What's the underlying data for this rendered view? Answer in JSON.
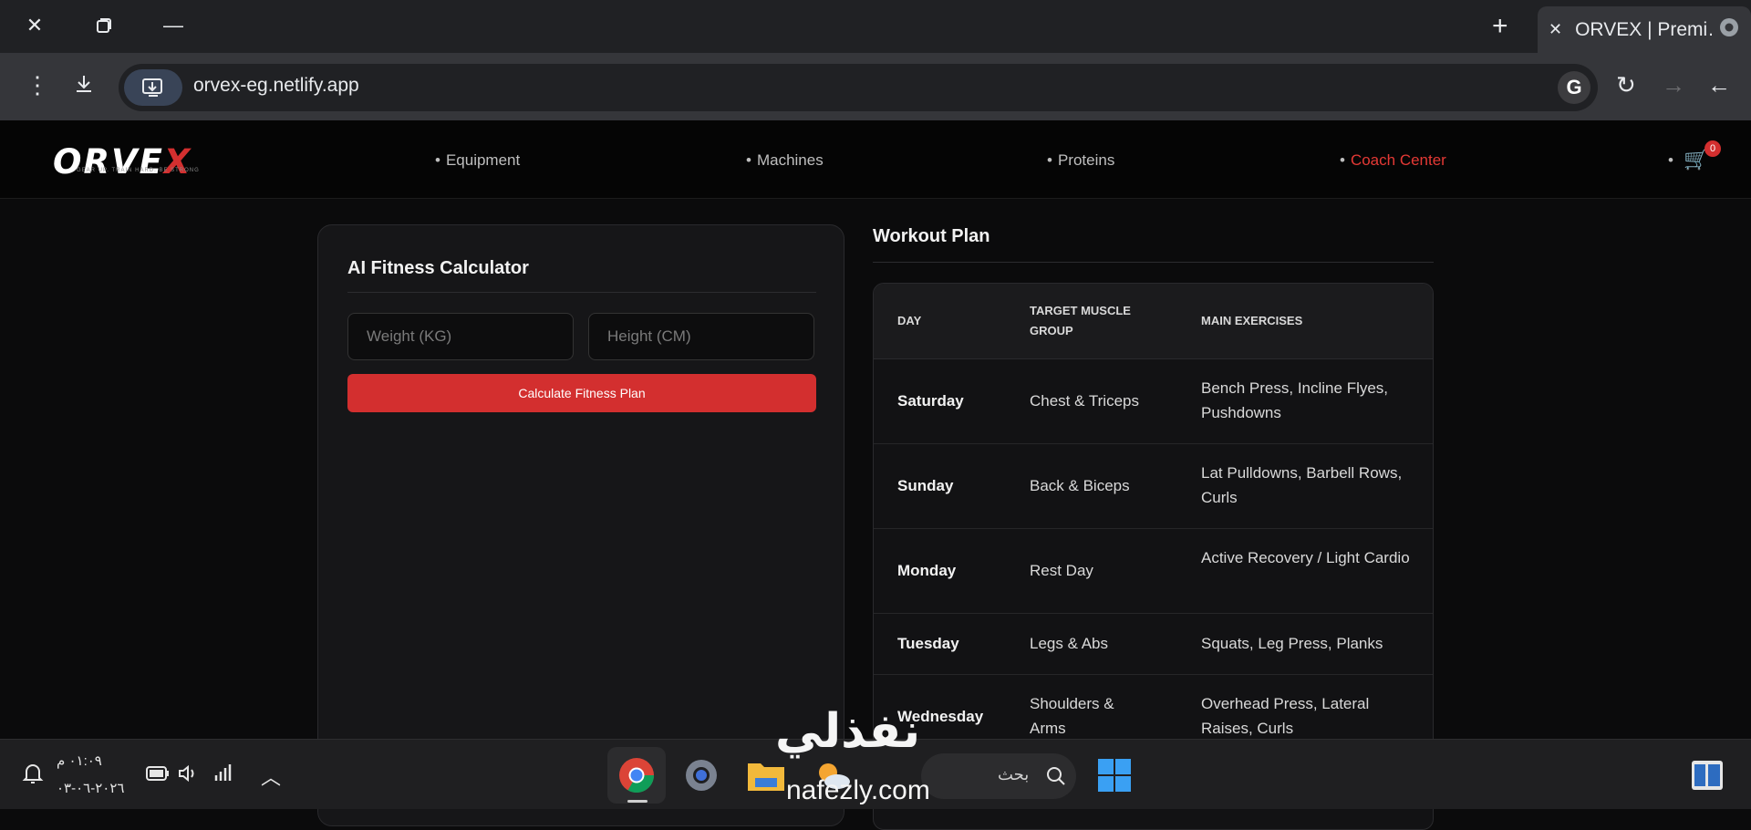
{
  "browser": {
    "tab_title": "ORVEX | Premi…",
    "url": "orvex-eg.netlify.app"
  },
  "site": {
    "logo": "ORVEX",
    "logo_tagline": "GEAR UP. TRAIN HARD. BE STRONG",
    "nav": [
      {
        "label": "Equipment"
      },
      {
        "label": "Machines"
      },
      {
        "label": "Proteins"
      },
      {
        "label": "Coach Center"
      }
    ],
    "cart_count": "0"
  },
  "calculator": {
    "title": "AI Fitness Calculator",
    "weight_placeholder": "Weight (KG)",
    "height_placeholder": "Height (CM)",
    "button_label": "Calculate Fitness Plan"
  },
  "workout": {
    "title": "Workout Plan",
    "headers": {
      "day": "DAY",
      "group_line1": "TARGET MUSCLE",
      "group_line2": "GROUP",
      "exercises": "MAIN EXERCISES"
    },
    "rows": [
      {
        "day": "Saturday",
        "group": "Chest & Triceps",
        "exercises": "Bench Press, Incline Flyes, Pushdowns"
      },
      {
        "day": "Sunday",
        "group": "Back & Biceps",
        "exercises": "Lat Pulldowns, Barbell Rows, Curls"
      },
      {
        "day": "Monday",
        "group": "Rest Day",
        "exercises": "Active Recovery / Light Cardio"
      },
      {
        "day": "Tuesday",
        "group": "Legs & Abs",
        "exercises": "Squats, Leg Press, Planks"
      },
      {
        "day": "Wednesday",
        "group": "Shoulders & Arms",
        "exercises": "Overhead Press, Lateral Raises, Curls"
      }
    ]
  },
  "watermark": {
    "arabic": "نفذلي",
    "latin": "nafezly.com"
  },
  "taskbar": {
    "time": "٠١:٠٩ م",
    "date": "٢٠٢٦-٠٦-٠٣",
    "search_label": "بحث"
  },
  "colors": {
    "accent": "#d32f2f",
    "background": "#0b0b0c",
    "card": "#161618"
  }
}
